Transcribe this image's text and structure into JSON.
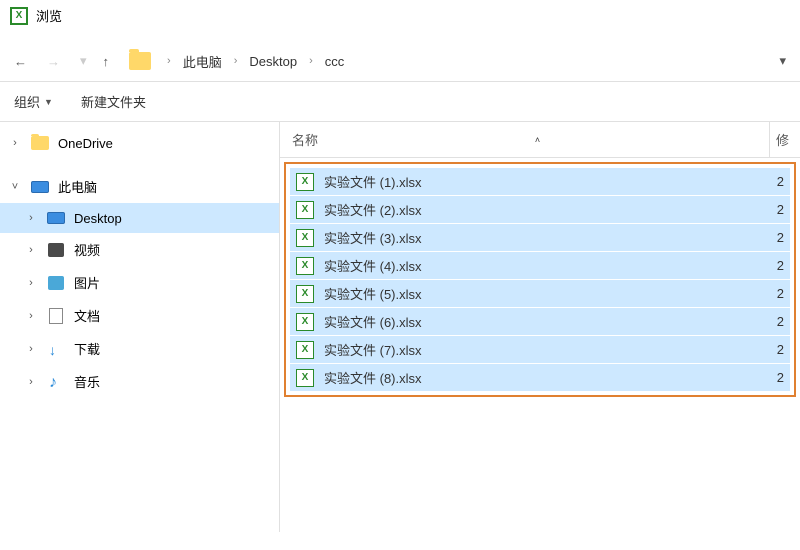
{
  "titlebar": {
    "title": "浏览"
  },
  "nav": {
    "breadcrumb": [
      "此电脑",
      "Desktop",
      "ccc"
    ]
  },
  "toolbar": {
    "organize": "组织",
    "new_folder": "新建文件夹"
  },
  "sidebar": {
    "items": [
      {
        "label": "OneDrive",
        "icon": "folder",
        "chevron": ">",
        "indent": 0
      },
      {
        "label": "此电脑",
        "icon": "monitor",
        "chevron": "v",
        "indent": 0
      },
      {
        "label": "Desktop",
        "icon": "monitor",
        "chevron": ">",
        "indent": 1,
        "selected": true
      },
      {
        "label": "视频",
        "icon": "video",
        "chevron": ">",
        "indent": 1
      },
      {
        "label": "图片",
        "icon": "pic",
        "chevron": ">",
        "indent": 1
      },
      {
        "label": "文档",
        "icon": "doc",
        "chevron": ">",
        "indent": 1
      },
      {
        "label": "下载",
        "icon": "dl",
        "chevron": ">",
        "indent": 1
      },
      {
        "label": "音乐",
        "icon": "music",
        "chevron": ">",
        "indent": 1
      }
    ]
  },
  "list": {
    "header_name": "名称",
    "header_other": "修",
    "files": [
      {
        "name": "实验文件 (1).xlsx",
        "col2": "2"
      },
      {
        "name": "实验文件 (2).xlsx",
        "col2": "2"
      },
      {
        "name": "实验文件 (3).xlsx",
        "col2": "2"
      },
      {
        "name": "实验文件 (4).xlsx",
        "col2": "2"
      },
      {
        "name": "实验文件 (5).xlsx",
        "col2": "2"
      },
      {
        "name": "实验文件 (6).xlsx",
        "col2": "2"
      },
      {
        "name": "实验文件 (7).xlsx",
        "col2": "2"
      },
      {
        "name": "实验文件 (8).xlsx",
        "col2": "2"
      }
    ]
  }
}
